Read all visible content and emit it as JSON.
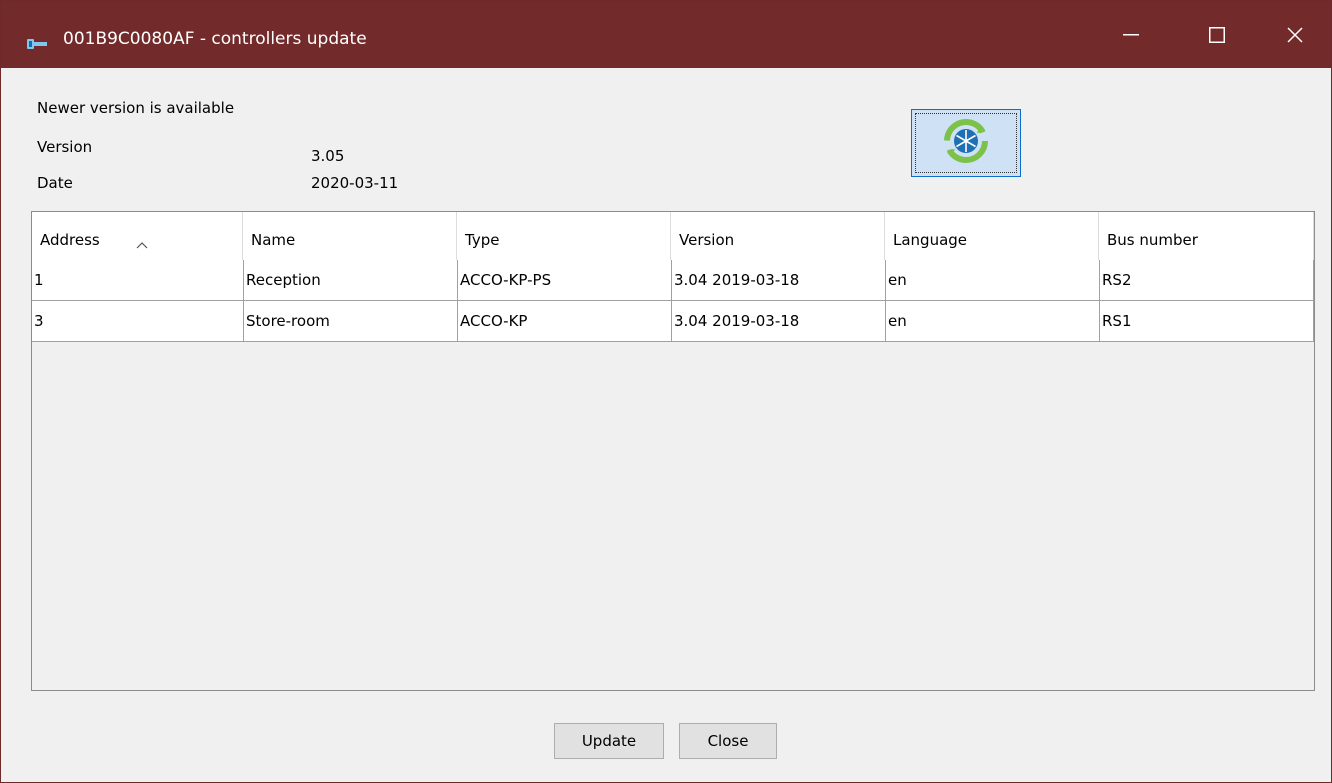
{
  "window": {
    "title": "001B9C0080AF - controllers update"
  },
  "info": {
    "status": "Newer version is available",
    "version_label": "Version",
    "version_value": "3.05",
    "date_label": "Date",
    "date_value": "2020-03-11"
  },
  "table": {
    "columns": [
      "Address",
      "Name",
      "Type",
      "Version",
      "Language",
      "Bus number"
    ],
    "sort_column": "Address",
    "rows": [
      [
        "1",
        "Reception",
        "ACCO-KP-PS",
        "3.04 2019-03-18",
        "en",
        "RS2"
      ],
      [
        "3",
        "Store-room",
        "ACCO-KP",
        "3.04 2019-03-18",
        "en",
        "RS1"
      ]
    ]
  },
  "buttons": {
    "update": "Update",
    "close": "Close"
  },
  "icons": {
    "app": "key-icon",
    "refresh": "update-refresh-icon"
  },
  "colors": {
    "titlebar": "#732a2b",
    "focus": "#0b6ecf"
  }
}
